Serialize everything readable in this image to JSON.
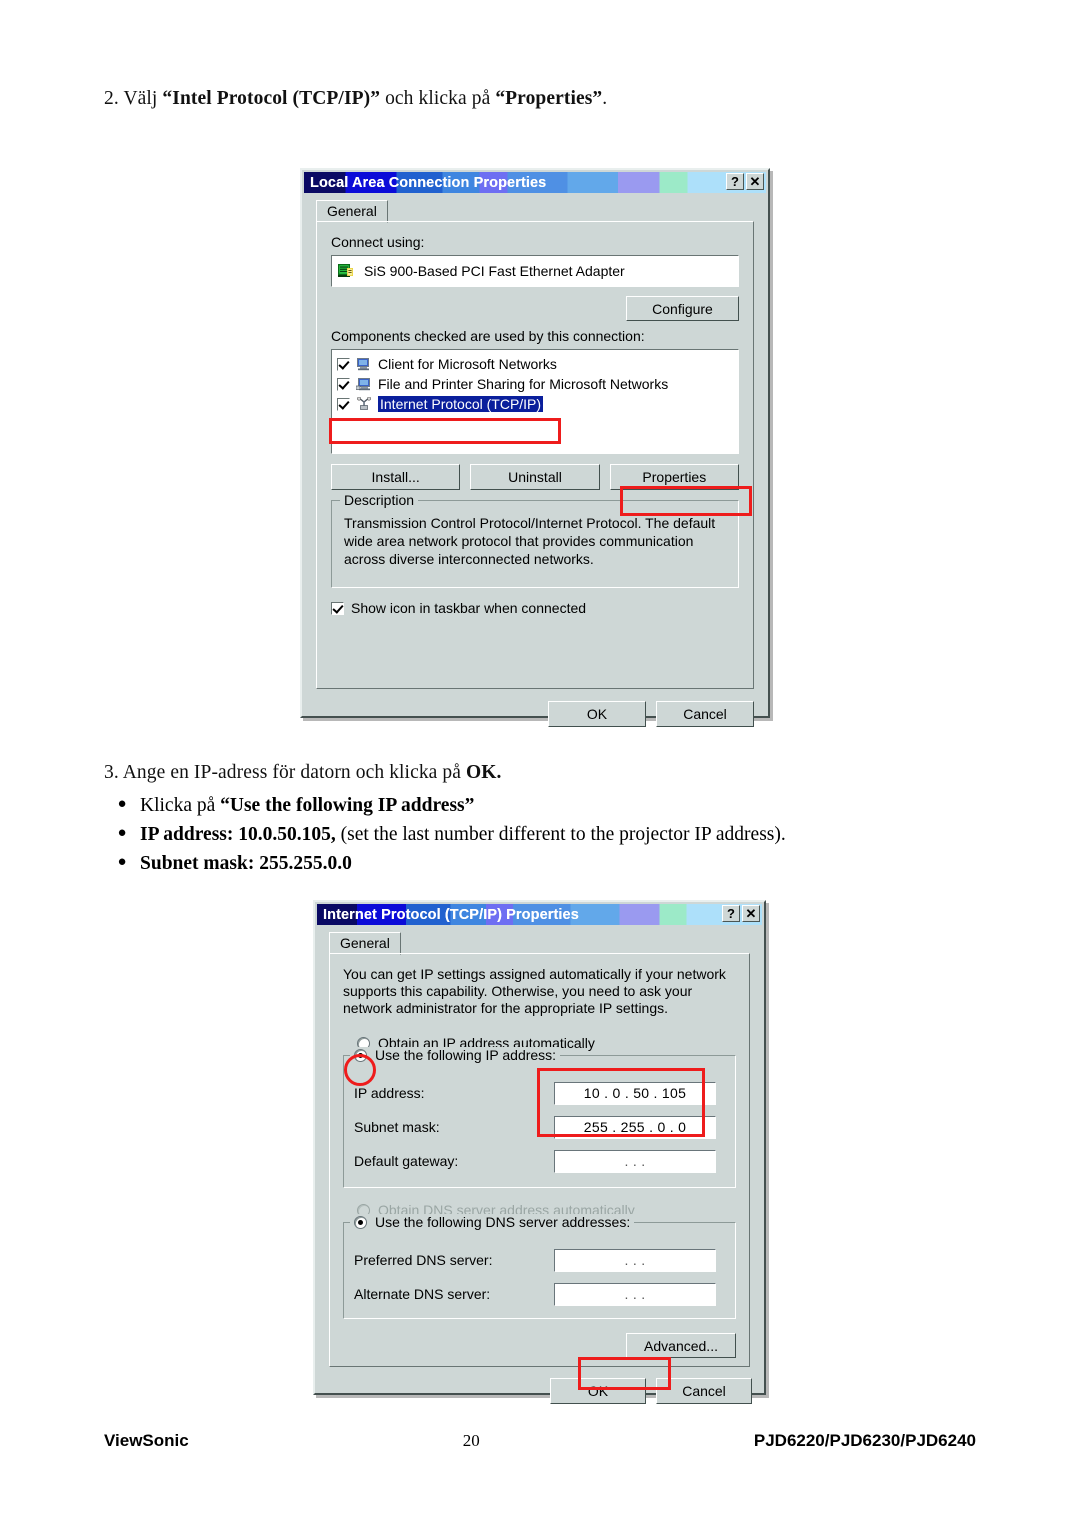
{
  "document": {
    "step2": {
      "prefix": "2. Välj ",
      "bold1": "“Intel Protocol (TCP/IP)”",
      "middle": " och klicka på ",
      "bold2": "“Properties”",
      "suffix": "."
    },
    "step3": {
      "prefix": "3. Ange en IP-adress för datorn och klicka på ",
      "bold": "OK."
    },
    "bullets": [
      {
        "normal_before": "Klicka på ",
        "bold": "“Use the following IP address”",
        "normal_after": ""
      },
      {
        "normal_before": "",
        "bold": "IP address: 10.0.50.105,",
        "normal_after": " (set the last number different to the projector IP address)."
      },
      {
        "normal_before": "",
        "bold": "Subnet mask: 255.255.0.0",
        "normal_after": ""
      }
    ],
    "bullet_glyph": "●"
  },
  "footer": {
    "brand": "ViewSonic",
    "page": "20",
    "models": "PJD6220/PJD6230/PJD6240"
  },
  "dialog1": {
    "title": "Local Area Connection Properties",
    "help_button": "?",
    "close_button": "✕",
    "tab": "General",
    "connect_using_label": "Connect using:",
    "adapter": "SiS 900-Based PCI Fast Ethernet Adapter",
    "adapter_icon": "network-adapter-icon",
    "configure_button": "Configure",
    "components_label": "Components checked are used by this connection:",
    "components": [
      {
        "label": "Client for Microsoft Networks",
        "checked": true,
        "selected": false,
        "icon": "computer-icon"
      },
      {
        "label": "File and Printer Sharing for Microsoft Networks",
        "checked": true,
        "selected": false,
        "icon": "computer-share-icon"
      },
      {
        "label": "Internet Protocol (TCP/IP)",
        "checked": true,
        "selected": true,
        "icon": "protocol-icon"
      }
    ],
    "install_button": "Install...",
    "uninstall_button": "Uninstall",
    "properties_button": "Properties",
    "description_group_title": "Description",
    "description_text": "Transmission Control Protocol/Internet Protocol. The default wide area network protocol that provides communication across diverse interconnected networks.",
    "show_icon_label": "Show icon in taskbar when connected",
    "show_icon_checked": true,
    "ok_button": "OK",
    "cancel_button": "Cancel"
  },
  "dialog2": {
    "title": "Internet Protocol (TCP/IP) Properties",
    "help_button": "?",
    "close_button": "✕",
    "tab": "General",
    "intro_text": "You can get IP settings assigned automatically if your network supports this capability. Otherwise, you need to ask your network administrator for the appropriate IP settings.",
    "radio_obtain_ip": "Obtain an IP address automatically",
    "radio_obtain_ip_selected": false,
    "radio_use_ip": "Use the following IP address:",
    "radio_use_ip_selected": true,
    "ip_address_label": "IP address:",
    "ip_address_value": "10 .  0  . 50 . 105",
    "subnet_mask_label": "Subnet mask:",
    "subnet_mask_value": "255 . 255 .  0  .  0",
    "default_gateway_label": "Default gateway:",
    "default_gateway_value": ".      .      .",
    "radio_obtain_dns": "Obtain DNS server address automatically",
    "radio_obtain_dns_selected": false,
    "radio_obtain_dns_disabled": true,
    "radio_use_dns": "Use the following DNS server addresses:",
    "radio_use_dns_selected": true,
    "preferred_dns_label": "Preferred DNS server:",
    "preferred_dns_value": ".      .      .",
    "alternate_dns_label": "Alternate DNS server:",
    "alternate_dns_value": ".      .      .",
    "advanced_button": "Advanced...",
    "ok_button": "OK",
    "cancel_button": "Cancel"
  },
  "annotations": {
    "accent_color": "#ee1c1c",
    "items": [
      {
        "name": "highlight-tcpip-row",
        "shape": "rect"
      },
      {
        "name": "highlight-properties-button",
        "shape": "rect"
      },
      {
        "name": "highlight-use-following-ip-radio",
        "shape": "circle"
      },
      {
        "name": "highlight-ip-fields",
        "shape": "rect"
      },
      {
        "name": "highlight-ok-button",
        "shape": "rect"
      }
    ]
  }
}
